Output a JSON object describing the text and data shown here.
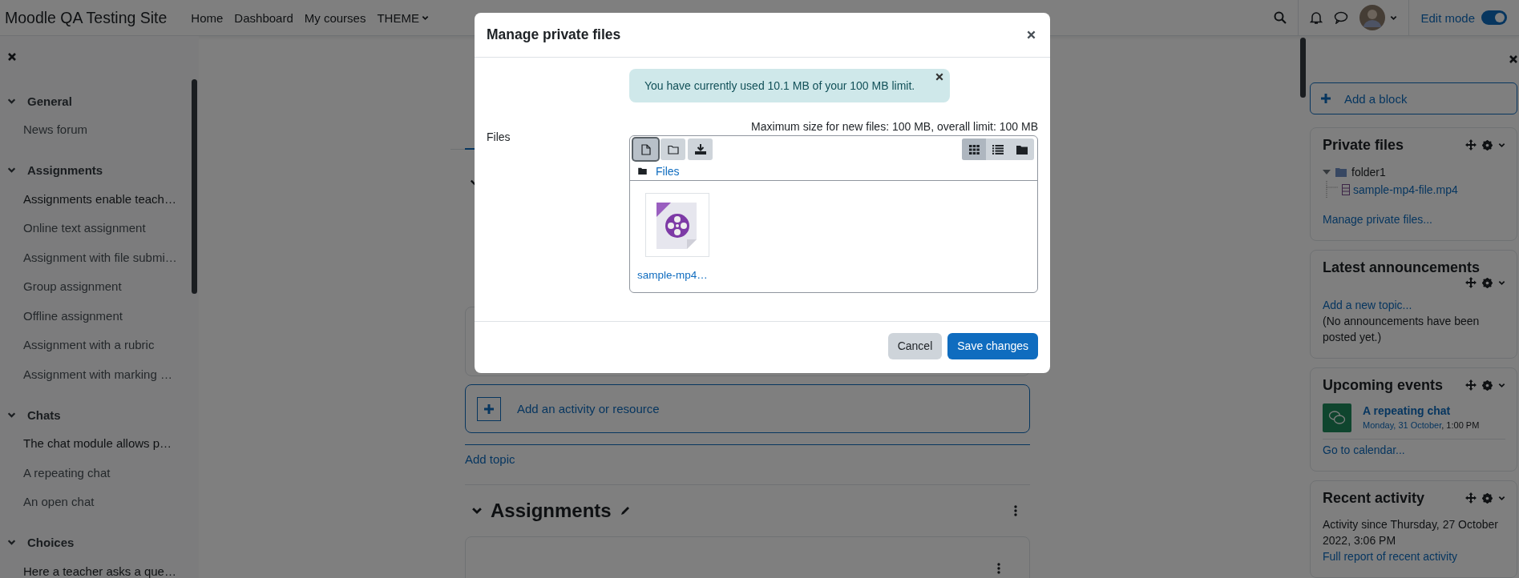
{
  "navbar": {
    "site_title": "Moodle QA Testing Site",
    "links": [
      {
        "label": "Home",
        "kind": "link"
      },
      {
        "label": "Dashboard",
        "kind": "link"
      },
      {
        "label": "My courses",
        "kind": "link"
      },
      {
        "label": "THEME",
        "kind": "dropdown"
      }
    ],
    "edit_mode": {
      "label": "Edit mode",
      "on": true
    }
  },
  "course_index": {
    "sections": [
      {
        "title": "General",
        "expanded": true,
        "items": [
          {
            "label": "News forum",
            "kind": "link"
          }
        ]
      },
      {
        "title": "Assignments",
        "expanded": true,
        "items": [
          {
            "label": "Assignments enable teach…",
            "kind": "label"
          },
          {
            "label": "Online text assignment",
            "kind": "link"
          },
          {
            "label": "Assignment with file submi…",
            "kind": "link"
          },
          {
            "label": "Group assignment",
            "kind": "link"
          },
          {
            "label": "Offline assignment",
            "kind": "link"
          },
          {
            "label": "Assignment with a rubric",
            "kind": "link"
          },
          {
            "label": "Assignment with marking …",
            "kind": "link"
          }
        ]
      },
      {
        "title": "Chats",
        "expanded": true,
        "items": [
          {
            "label": "The chat module allows p…",
            "kind": "label"
          },
          {
            "label": "A repeating chat",
            "kind": "link"
          },
          {
            "label": "An open chat",
            "kind": "link"
          }
        ]
      },
      {
        "title": "Choices",
        "expanded": true,
        "items": [
          {
            "label": "Here a teacher asks a que…",
            "kind": "label"
          }
        ]
      }
    ]
  },
  "main": {
    "add_activity": "Add an activity or resource",
    "add_topic": "Add topic",
    "section": {
      "title": "Assignments",
      "expanded": true
    }
  },
  "blocks_drawer": {
    "add_block": "Add a block",
    "blocks": [
      {
        "kind": "private_files",
        "title": "Private files",
        "tree": [
          {
            "label": "folder1",
            "kind": "folder",
            "expanded": true,
            "children": [
              {
                "label": "sample-mp4-file.mp4",
                "kind": "file"
              }
            ]
          }
        ],
        "link": "Manage private files..."
      },
      {
        "kind": "announcements",
        "title": "Latest announcements",
        "link": "Add a new topic...",
        "note": "(No announcements have been posted yet.)"
      },
      {
        "kind": "events",
        "title": "Upcoming events",
        "event": {
          "title": "A repeating chat",
          "date": "Monday, 31 October",
          "time": ", 1:00 PM"
        },
        "link": "Go to calendar..."
      },
      {
        "kind": "recent",
        "title": "Recent activity",
        "note": "Activity since Thursday, 27 October 2022, 3:06 PM",
        "link": "Full report of recent activity"
      }
    ]
  },
  "modal": {
    "title": "Manage private files",
    "alert": "You have currently used 10.1 MB of your 100 MB limit.",
    "field_label": "Files",
    "limits": "Maximum size for new files: 100 MB, overall limit: 100 MB",
    "toolbar": [
      {
        "kind": "add_file",
        "focused": true
      },
      {
        "kind": "create_folder",
        "focused": false
      },
      {
        "kind": "download",
        "focused": false
      }
    ],
    "views": [
      {
        "kind": "icons",
        "selected": true
      },
      {
        "kind": "list",
        "selected": false
      },
      {
        "kind": "tree",
        "selected": false
      }
    ],
    "path": "Files",
    "files": [
      {
        "name": "sample-mp4…",
        "kind": "video"
      }
    ],
    "buttons": [
      {
        "label": "Cancel",
        "kind": "secondary"
      },
      {
        "label": "Save changes",
        "kind": "primary"
      }
    ]
  }
}
